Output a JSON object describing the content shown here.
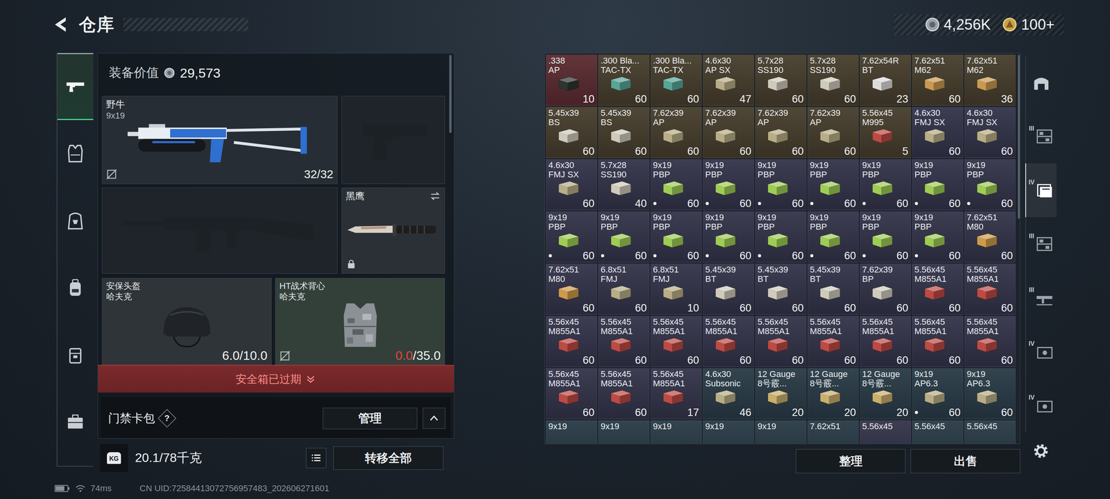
{
  "header": {
    "title": "仓库",
    "currencies": [
      {
        "kind": "silver",
        "amount": "4,256K"
      },
      {
        "kind": "gold",
        "amount": "100+"
      }
    ]
  },
  "left_tabs": [
    {
      "kind": "pistol",
      "selected": true
    },
    {
      "kind": "vest",
      "selected": false
    },
    {
      "kind": "rig",
      "selected": false
    },
    {
      "kind": "backpack",
      "selected": false
    },
    {
      "kind": "pouch",
      "selected": false
    },
    {
      "kind": "case",
      "selected": false
    }
  ],
  "loadout": {
    "value_label": "装备价值",
    "value": "29,573",
    "primary": {
      "name": "野牛",
      "caliber": "9x19",
      "ammo": "32/32",
      "uninsured": true
    },
    "sidearm": {
      "empty": true
    },
    "secondary": {
      "empty": true
    },
    "melee": {
      "name": "黑鹰",
      "locked": true
    },
    "armor": [
      {
        "kind": "helmet",
        "name": "安保头盔",
        "brand": "哈夫克",
        "current": "6.0",
        "max": "/10.0",
        "low": false,
        "uninsured": false,
        "color": "#2f3439"
      },
      {
        "kind": "vest",
        "name": "HT战术背心",
        "brand": "哈夫克",
        "current": "0.0",
        "max": "/35.0",
        "low": true,
        "uninsured": true,
        "color": "#33403a"
      }
    ],
    "safe_box": {
      "label": "安全箱已过期",
      "expanded": false
    },
    "keycard": {
      "label": "门禁卡包",
      "help": "?",
      "button": "管理",
      "expanded": true
    },
    "weight": {
      "icon_label": "KG",
      "value": "20.1/78千克"
    },
    "transfer_button": "转移全部"
  },
  "stash": {
    "buttons": [
      "整理",
      "出售"
    ],
    "items": [
      {
        "cal": ".338",
        "type": "AP",
        "count": "10",
        "tint": "#5a2a30",
        "box": "#2e3530",
        "marked": false
      },
      {
        "cal": ".300 Bla...",
        "type": "TAC-TX",
        "count": "60",
        "tint": "#463d2c",
        "box": "#58a596",
        "marked": false
      },
      {
        "cal": ".300 Bla...",
        "type": "TAC-TX",
        "count": "60",
        "tint": "#463d2c",
        "box": "#58a596",
        "marked": false
      },
      {
        "cal": "4.6x30",
        "type": "AP SX",
        "count": "47",
        "tint": "#463d2c",
        "box": "#b8ad86",
        "marked": false
      },
      {
        "cal": "5.7x28",
        "type": "SS190",
        "count": "60",
        "tint": "#463d2c",
        "box": "#cfcabb",
        "marked": false
      },
      {
        "cal": "5.7x28",
        "type": "SS190",
        "count": "60",
        "tint": "#463d2c",
        "box": "#cfcabb",
        "marked": false
      },
      {
        "cal": "7.62x54R",
        "type": "BT",
        "count": "23",
        "tint": "#463d2c",
        "box": "#dcdcdc",
        "marked": false
      },
      {
        "cal": "7.62x51",
        "type": "M62",
        "count": "60",
        "tint": "#463d2c",
        "box": "#c99a52",
        "marked": false
      },
      {
        "cal": "7.62x51",
        "type": "M62",
        "count": "36",
        "tint": "#463d2c",
        "box": "#c99a52",
        "marked": false
      },
      {
        "cal": "5.45x39",
        "type": "BS",
        "count": "60",
        "tint": "#463d2c",
        "box": "#cfcabb",
        "marked": false
      },
      {
        "cal": "5.45x39",
        "type": "BS",
        "count": "60",
        "tint": "#463d2c",
        "box": "#cfcabb",
        "marked": false
      },
      {
        "cal": "7.62x39",
        "type": "AP",
        "count": "60",
        "tint": "#463d2c",
        "box": "#b8ad86",
        "marked": false
      },
      {
        "cal": "7.62x39",
        "type": "AP",
        "count": "60",
        "tint": "#463d2c",
        "box": "#b8ad86",
        "marked": false
      },
      {
        "cal": "7.62x39",
        "type": "AP",
        "count": "60",
        "tint": "#463d2c",
        "box": "#b8ad86",
        "marked": false
      },
      {
        "cal": "7.62x39",
        "type": "AP",
        "count": "60",
        "tint": "#463d2c",
        "box": "#b8ad86",
        "marked": false
      },
      {
        "cal": "5.56x45",
        "type": "M995",
        "count": "5",
        "tint": "#463d2c",
        "box": "#bd4a44",
        "marked": false
      },
      {
        "cal": "4.6x30",
        "type": "FMJ SX",
        "count": "60",
        "tint": "#33334a",
        "box": "#b8ad86",
        "marked": false
      },
      {
        "cal": "4.6x30",
        "type": "FMJ SX",
        "count": "60",
        "tint": "#33334a",
        "box": "#b8ad86",
        "marked": false
      },
      {
        "cal": "4.6x30",
        "type": "FMJ SX",
        "count": "60",
        "tint": "#33334a",
        "box": "#b8ad86",
        "marked": false
      },
      {
        "cal": "5.7x28",
        "type": "SS190",
        "count": "40",
        "tint": "#33334a",
        "box": "#cfcabb",
        "marked": false
      },
      {
        "cal": "9x19",
        "type": "PBP",
        "count": "60",
        "tint": "#33334a",
        "box": "#9fcc55",
        "marked": true
      },
      {
        "cal": "9x19",
        "type": "PBP",
        "count": "60",
        "tint": "#33334a",
        "box": "#9fcc55",
        "marked": true
      },
      {
        "cal": "9x19",
        "type": "PBP",
        "count": "60",
        "tint": "#33334a",
        "box": "#9fcc55",
        "marked": true
      },
      {
        "cal": "9x19",
        "type": "PBP",
        "count": "60",
        "tint": "#33334a",
        "box": "#9fcc55",
        "marked": true
      },
      {
        "cal": "9x19",
        "type": "PBP",
        "count": "60",
        "tint": "#33334a",
        "box": "#9fcc55",
        "marked": true
      },
      {
        "cal": "9x19",
        "type": "PBP",
        "count": "60",
        "tint": "#33334a",
        "box": "#9fcc55",
        "marked": true
      },
      {
        "cal": "9x19",
        "type": "PBP",
        "count": "60",
        "tint": "#33334a",
        "box": "#9fcc55",
        "marked": true
      },
      {
        "cal": "9x19",
        "type": "PBP",
        "count": "60",
        "tint": "#33334a",
        "box": "#9fcc55",
        "marked": true
      },
      {
        "cal": "9x19",
        "type": "PBP",
        "count": "60",
        "tint": "#33334a",
        "box": "#9fcc55",
        "marked": true
      },
      {
        "cal": "9x19",
        "type": "PBP",
        "count": "60",
        "tint": "#33334a",
        "box": "#9fcc55",
        "marked": true
      },
      {
        "cal": "9x19",
        "type": "PBP",
        "count": "60",
        "tint": "#33334a",
        "box": "#9fcc55",
        "marked": true
      },
      {
        "cal": "9x19",
        "type": "PBP",
        "count": "60",
        "tint": "#33334a",
        "box": "#9fcc55",
        "marked": true
      },
      {
        "cal": "9x19",
        "type": "PBP",
        "count": "60",
        "tint": "#33334a",
        "box": "#9fcc55",
        "marked": true
      },
      {
        "cal": "9x19",
        "type": "PBP",
        "count": "60",
        "tint": "#33334a",
        "box": "#9fcc55",
        "marked": true
      },
      {
        "cal": "9x19",
        "type": "PBP",
        "count": "60",
        "tint": "#33334a",
        "box": "#9fcc55",
        "marked": true
      },
      {
        "cal": "7.62x51",
        "type": "M80",
        "count": "60",
        "tint": "#33334a",
        "box": "#cf9b4a",
        "marked": false
      },
      {
        "cal": "7.62x51",
        "type": "M80",
        "count": "60",
        "tint": "#33334a",
        "box": "#cf9b4a",
        "marked": false
      },
      {
        "cal": "6.8x51",
        "type": "FMJ",
        "count": "60",
        "tint": "#33334a",
        "box": "#b8ad86",
        "marked": false
      },
      {
        "cal": "6.8x51",
        "type": "FMJ",
        "count": "10",
        "tint": "#33334a",
        "box": "#b8ad86",
        "marked": false
      },
      {
        "cal": "5.45x39",
        "type": "BT",
        "count": "60",
        "tint": "#33334a",
        "box": "#cfcabb",
        "marked": false
      },
      {
        "cal": "5.45x39",
        "type": "BT",
        "count": "60",
        "tint": "#33334a",
        "box": "#cfcabb",
        "marked": false
      },
      {
        "cal": "5.45x39",
        "type": "BT",
        "count": "60",
        "tint": "#33334a",
        "box": "#cfcabb",
        "marked": false
      },
      {
        "cal": "7.62x39",
        "type": "BP",
        "count": "60",
        "tint": "#33334a",
        "box": "#cfcabb",
        "marked": false
      },
      {
        "cal": "5.56x45",
        "type": "M855A1",
        "count": "60",
        "tint": "#33334a",
        "box": "#bd4a44",
        "marked": false
      },
      {
        "cal": "5.56x45",
        "type": "M855A1",
        "count": "60",
        "tint": "#33334a",
        "box": "#bd4a44",
        "marked": false
      },
      {
        "cal": "5.56x45",
        "type": "M855A1",
        "count": "60",
        "tint": "#33334a",
        "box": "#bd4a44",
        "marked": false
      },
      {
        "cal": "5.56x45",
        "type": "M855A1",
        "count": "60",
        "tint": "#33334a",
        "box": "#bd4a44",
        "marked": false
      },
      {
        "cal": "5.56x45",
        "type": "M855A1",
        "count": "60",
        "tint": "#33334a",
        "box": "#bd4a44",
        "marked": false
      },
      {
        "cal": "5.56x45",
        "type": "M855A1",
        "count": "60",
        "tint": "#33334a",
        "box": "#bd4a44",
        "marked": false
      },
      {
        "cal": "5.56x45",
        "type": "M855A1",
        "count": "60",
        "tint": "#33334a",
        "box": "#bd4a44",
        "marked": false
      },
      {
        "cal": "5.56x45",
        "type": "M855A1",
        "count": "60",
        "tint": "#33334a",
        "box": "#bd4a44",
        "marked": false
      },
      {
        "cal": "5.56x45",
        "type": "M855A1",
        "count": "60",
        "tint": "#33334a",
        "box": "#bd4a44",
        "marked": false
      },
      {
        "cal": "5.56x45",
        "type": "M855A1",
        "count": "60",
        "tint": "#33334a",
        "box": "#bd4a44",
        "marked": false
      },
      {
        "cal": "5.56x45",
        "type": "M855A1",
        "count": "60",
        "tint": "#33334a",
        "box": "#bd4a44",
        "marked": false
      },
      {
        "cal": "5.56x45",
        "type": "M855A1",
        "count": "60",
        "tint": "#33334a",
        "box": "#bd4a44",
        "marked": false
      },
      {
        "cal": "5.56x45",
        "type": "M855A1",
        "count": "60",
        "tint": "#33334a",
        "box": "#bd4a44",
        "marked": false
      },
      {
        "cal": "5.56x45",
        "type": "M855A1",
        "count": "17",
        "tint": "#33334a",
        "box": "#bd4a44",
        "marked": false
      },
      {
        "cal": "4.6x30",
        "type": "Subsonic",
        "count": "46",
        "tint": "#283a46",
        "box": "#b8ad86",
        "marked": false
      },
      {
        "cal": "12 Gauge",
        "type": "8号霰...",
        "count": "20",
        "tint": "#283a46",
        "box": "#c9ae6c",
        "marked": false
      },
      {
        "cal": "12 Gauge",
        "type": "8号霰...",
        "count": "20",
        "tint": "#283a46",
        "box": "#c9ae6c",
        "marked": false
      },
      {
        "cal": "12 Gauge",
        "type": "8号霰...",
        "count": "20",
        "tint": "#283a46",
        "box": "#c9ae6c",
        "marked": false
      },
      {
        "cal": "9x19",
        "type": "AP6.3",
        "count": "60",
        "tint": "#283a46",
        "box": "#b8ad86",
        "marked": true
      },
      {
        "cal": "9x19",
        "type": "AP6.3",
        "count": "60",
        "tint": "#283a46",
        "box": "#b8ad86",
        "marked": false
      },
      {
        "cal": "9x19",
        "tint": "#283a46",
        "marked": false
      },
      {
        "cal": "9x19",
        "tint": "#283a46",
        "marked": false
      },
      {
        "cal": "9x19",
        "tint": "#283a46",
        "marked": false
      },
      {
        "cal": "9x19",
        "tint": "#283a46",
        "marked": false
      },
      {
        "cal": "9x19",
        "tint": "#283a46",
        "marked": false
      },
      {
        "cal": "7.62x51",
        "tint": "#283a46",
        "marked": false
      },
      {
        "cal": "5.56x45",
        "tint": "#33334a",
        "marked": false
      },
      {
        "cal": "5.56x45",
        "tint": "#283a46",
        "marked": false
      },
      {
        "cal": "5.56x45",
        "tint": "#283a46",
        "marked": false
      }
    ]
  },
  "right_tabs": [
    {
      "kind": "arch",
      "label": "",
      "selected": false
    },
    {
      "kind": "grid",
      "label": "III",
      "selected": false
    },
    {
      "kind": "stack",
      "label": "IV",
      "selected": true
    },
    {
      "kind": "grid",
      "label": "III",
      "selected": false
    },
    {
      "kind": "rifle",
      "label": "III",
      "selected": false
    },
    {
      "kind": "crate",
      "label": "IV",
      "selected": false
    },
    {
      "kind": "crate",
      "label": "IV",
      "selected": false
    }
  ],
  "status": {
    "battery_level": 0.75,
    "ping": "74ms",
    "uid": "CN UID:72584413072756957483_202606271601"
  }
}
